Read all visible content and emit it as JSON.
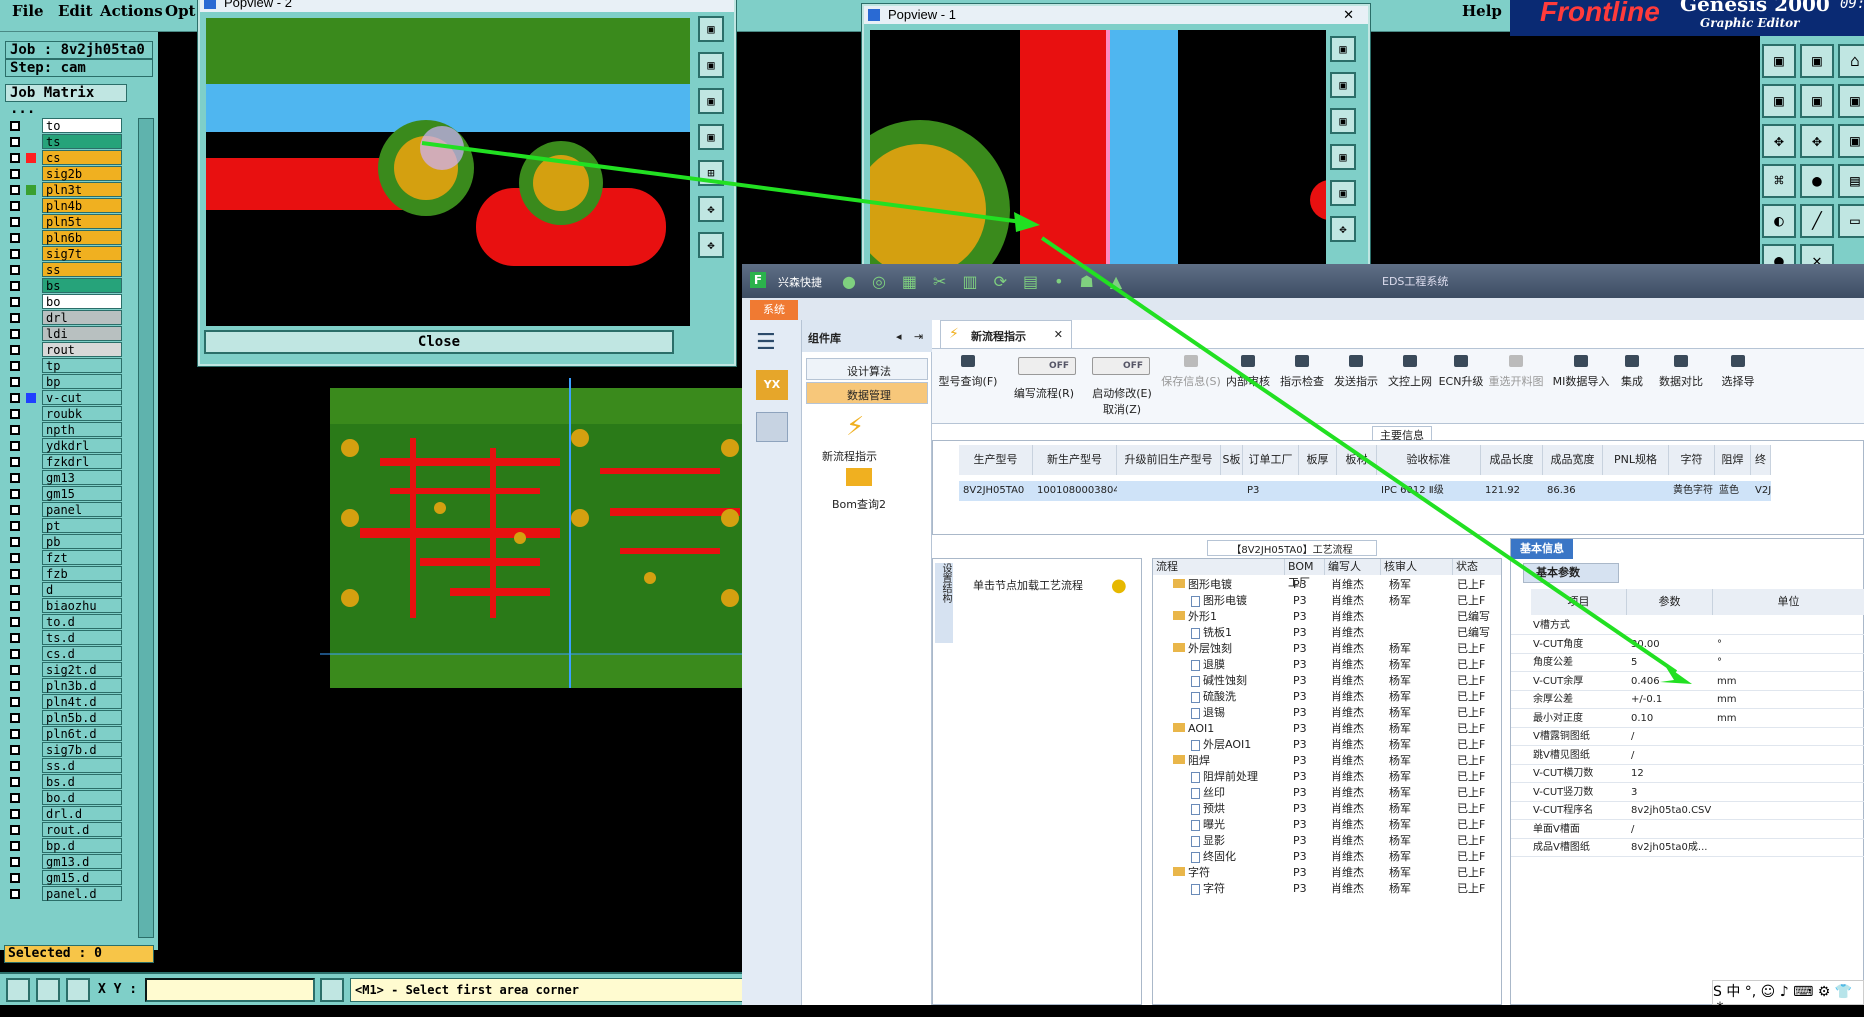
{
  "menubar": {
    "file": "File",
    "edit": "Edit",
    "actions": "Actions",
    "opt": "Opt",
    "help": "Help"
  },
  "branding": {
    "logo": "Frontline",
    "genesis": "Genesis 2000",
    "graphic_editor": "Graphic Editor",
    "clock": "09:3"
  },
  "job": {
    "job_label": "Job : 8v2jh05ta0",
    "step_label": "Step: cam",
    "matrix_button": "Job Matrix ..."
  },
  "layers": [
    {
      "name": "to",
      "color": "#ffffff",
      "swatch": ""
    },
    {
      "name": "ts",
      "color": "#26a37a",
      "swatch": ""
    },
    {
      "name": "cs",
      "color": "#f0b020",
      "swatch": "#ff2020"
    },
    {
      "name": "sig2b",
      "color": "#f0b020",
      "swatch": ""
    },
    {
      "name": "pln3t",
      "color": "#f0b020",
      "swatch": "#3aa030"
    },
    {
      "name": "pln4b",
      "color": "#f0b020",
      "swatch": ""
    },
    {
      "name": "pln5t",
      "color": "#f0b020",
      "swatch": ""
    },
    {
      "name": "pln6b",
      "color": "#f0b020",
      "swatch": ""
    },
    {
      "name": "sig7t",
      "color": "#f0b020",
      "swatch": ""
    },
    {
      "name": "ss",
      "color": "#f0b020",
      "swatch": ""
    },
    {
      "name": "bs",
      "color": "#26a37a",
      "swatch": ""
    },
    {
      "name": "bo",
      "color": "#ffffff",
      "swatch": ""
    },
    {
      "name": "drl",
      "color": "#b8c0c0",
      "swatch": ""
    },
    {
      "name": "ldi",
      "color": "#b8c0c0",
      "swatch": ""
    },
    {
      "name": "rout",
      "color": "#d8d8d8",
      "swatch": ""
    },
    {
      "name": "tp",
      "color": "#7fcfc8",
      "swatch": ""
    },
    {
      "name": "bp",
      "color": "#7fcfc8",
      "swatch": ""
    },
    {
      "name": "v-cut",
      "color": "#7fcfc8",
      "swatch": "#2040ff"
    },
    {
      "name": "roubk",
      "color": "#7fcfc8",
      "swatch": ""
    },
    {
      "name": "npth",
      "color": "#7fcfc8",
      "swatch": ""
    },
    {
      "name": "ydkdrl",
      "color": "#7fcfc8",
      "swatch": ""
    },
    {
      "name": "fzkdrl",
      "color": "#7fcfc8",
      "swatch": ""
    },
    {
      "name": "gm13",
      "color": "#7fcfc8",
      "swatch": ""
    },
    {
      "name": "gm15",
      "color": "#7fcfc8",
      "swatch": ""
    },
    {
      "name": "panel",
      "color": "#7fcfc8",
      "swatch": ""
    },
    {
      "name": "pt",
      "color": "#7fcfc8",
      "swatch": ""
    },
    {
      "name": "pb",
      "color": "#7fcfc8",
      "swatch": ""
    },
    {
      "name": "fzt",
      "color": "#7fcfc8",
      "swatch": ""
    },
    {
      "name": "fzb",
      "color": "#7fcfc8",
      "swatch": ""
    },
    {
      "name": "d",
      "color": "#7fcfc8",
      "swatch": ""
    },
    {
      "name": "biaozhu",
      "color": "#7fcfc8",
      "swatch": ""
    },
    {
      "name": "to.d",
      "color": "#7fcfc8",
      "swatch": ""
    },
    {
      "name": "ts.d",
      "color": "#7fcfc8",
      "swatch": ""
    },
    {
      "name": "cs.d",
      "color": "#7fcfc8",
      "swatch": ""
    },
    {
      "name": "sig2t.d",
      "color": "#7fcfc8",
      "swatch": ""
    },
    {
      "name": "pln3b.d",
      "color": "#7fcfc8",
      "swatch": ""
    },
    {
      "name": "pln4t.d",
      "color": "#7fcfc8",
      "swatch": ""
    },
    {
      "name": "pln5b.d",
      "color": "#7fcfc8",
      "swatch": ""
    },
    {
      "name": "pln6t.d",
      "color": "#7fcfc8",
      "swatch": ""
    },
    {
      "name": "sig7b.d",
      "color": "#7fcfc8",
      "swatch": ""
    },
    {
      "name": "ss.d",
      "color": "#7fcfc8",
      "swatch": ""
    },
    {
      "name": "bs.d",
      "color": "#7fcfc8",
      "swatch": ""
    },
    {
      "name": "bo.d",
      "color": "#7fcfc8",
      "swatch": ""
    },
    {
      "name": "drl.d",
      "color": "#7fcfc8",
      "swatch": ""
    },
    {
      "name": "rout.d",
      "color": "#7fcfc8",
      "swatch": ""
    },
    {
      "name": "bp.d",
      "color": "#7fcfc8",
      "swatch": ""
    },
    {
      "name": "gm13.d",
      "color": "#7fcfc8",
      "swatch": ""
    },
    {
      "name": "gm15.d",
      "color": "#7fcfc8",
      "swatch": ""
    },
    {
      "name": "panel.d",
      "color": "#7fcfc8",
      "swatch": ""
    }
  ],
  "selected_label": "Selected : 0",
  "status": {
    "xy_label": "X Y :",
    "xy_value": "",
    "prompt": "<M1> - Select first area corner"
  },
  "popview2": {
    "title": "Popview - 2",
    "close": "Close"
  },
  "popview1": {
    "title": "Popview - 1"
  },
  "eds": {
    "title": "EDS工程系统",
    "app_name": "兴森快捷",
    "sys_tab": "系统",
    "lib_title": "组件库",
    "lib_items": [
      "设计算法",
      "数据管理"
    ],
    "lib_links": [
      "新流程指示",
      "Bom查询2"
    ],
    "doc_tab": "新流程指示",
    "ribbon": [
      "型号查询(F)",
      "编写流程(R)",
      "启动修改(E)",
      "取消(Z)",
      "保存信息(S)",
      "内部审核",
      "指示检查",
      "发送指示",
      "文控上网",
      "ECN升级",
      "重选开料图",
      "MI数据导入",
      "集成",
      "数据对比",
      "选择导"
    ],
    "toggle": "OFF",
    "main_info": "主要信息",
    "grid_headers": [
      "生产型号",
      "新生产型号",
      "升级前旧生产型号",
      "S板",
      "订单工厂",
      "板厚",
      "板材",
      "验收标准",
      "成品长度",
      "成品宽度",
      "PNL规格",
      "字符",
      "阻焊",
      "终"
    ],
    "grid_row": [
      "8V2JH05TA0",
      "10010800038040",
      "",
      "",
      "P3",
      "",
      "",
      "IPC 6012 Ⅱ级",
      "121.92",
      "86.36",
      "",
      "黄色字符",
      "蓝色",
      "V2J"
    ],
    "flow_label": "【8V2JH05TA0】工艺流程",
    "left_vert": "设置结构",
    "add_flow": "单击节点加载工艺流程",
    "flow_headers": [
      "流程",
      "BOM工厂",
      "编写人",
      "核审人",
      "状态"
    ],
    "flow_rows": [
      {
        "lvl": 0,
        "t": "folder",
        "name": "图形电镀",
        "bom": "P3",
        "w": "肖维杰",
        "r": "杨军",
        "s": "已上F"
      },
      {
        "lvl": 1,
        "t": "doc",
        "name": "图形电镀",
        "bom": "P3",
        "w": "肖维杰",
        "r": "杨军",
        "s": "已上F"
      },
      {
        "lvl": 0,
        "t": "folder",
        "name": "外形1",
        "bom": "P3",
        "w": "肖维杰",
        "r": "",
        "s": "已编写"
      },
      {
        "lvl": 1,
        "t": "doc",
        "name": "铣板1",
        "bom": "P3",
        "w": "肖维杰",
        "r": "",
        "s": "已编写"
      },
      {
        "lvl": 0,
        "t": "folder",
        "name": "外层蚀刻",
        "bom": "P3",
        "w": "肖维杰",
        "r": "杨军",
        "s": "已上F"
      },
      {
        "lvl": 1,
        "t": "doc",
        "name": "退膜",
        "bom": "P3",
        "w": "肖维杰",
        "r": "杨军",
        "s": "已上F"
      },
      {
        "lvl": 1,
        "t": "doc",
        "name": "碱性蚀刻",
        "bom": "P3",
        "w": "肖维杰",
        "r": "杨军",
        "s": "已上F"
      },
      {
        "lvl": 1,
        "t": "doc",
        "name": "硫酸洗",
        "bom": "P3",
        "w": "肖维杰",
        "r": "杨军",
        "s": "已上F"
      },
      {
        "lvl": 1,
        "t": "doc",
        "name": "退锡",
        "bom": "P3",
        "w": "肖维杰",
        "r": "杨军",
        "s": "已上F"
      },
      {
        "lvl": 0,
        "t": "folder",
        "name": "AOI1",
        "bom": "P3",
        "w": "肖维杰",
        "r": "杨军",
        "s": "已上F"
      },
      {
        "lvl": 1,
        "t": "doc",
        "name": "外层AOI1",
        "bom": "P3",
        "w": "肖维杰",
        "r": "杨军",
        "s": "已上F"
      },
      {
        "lvl": 0,
        "t": "folder",
        "name": "阻焊",
        "bom": "P3",
        "w": "肖维杰",
        "r": "杨军",
        "s": "已上F"
      },
      {
        "lvl": 1,
        "t": "doc",
        "name": "阻焊前处理",
        "bom": "P3",
        "w": "肖维杰",
        "r": "杨军",
        "s": "已上F"
      },
      {
        "lvl": 1,
        "t": "doc",
        "name": "丝印",
        "bom": "P3",
        "w": "肖维杰",
        "r": "杨军",
        "s": "已上F"
      },
      {
        "lvl": 1,
        "t": "doc",
        "name": "预烘",
        "bom": "P3",
        "w": "肖维杰",
        "r": "杨军",
        "s": "已上F"
      },
      {
        "lvl": 1,
        "t": "doc",
        "name": "曝光",
        "bom": "P3",
        "w": "肖维杰",
        "r": "杨军",
        "s": "已上F"
      },
      {
        "lvl": 1,
        "t": "doc",
        "name": "显影",
        "bom": "P3",
        "w": "肖维杰",
        "r": "杨军",
        "s": "已上F"
      },
      {
        "lvl": 1,
        "t": "doc",
        "name": "终固化",
        "bom": "P3",
        "w": "肖维杰",
        "r": "杨军",
        "s": "已上F"
      },
      {
        "lvl": 0,
        "t": "folder",
        "name": "字符",
        "bom": "P3",
        "w": "肖维杰",
        "r": "杨军",
        "s": "已上F"
      },
      {
        "lvl": 1,
        "t": "doc",
        "name": "字符",
        "bom": "P3",
        "w": "肖维杰",
        "r": "杨军",
        "s": "已上F"
      }
    ],
    "basic_tab": "基本信息",
    "basic_params_tab": "基本参数",
    "basic_headers": [
      "项目",
      "参数",
      "单位"
    ],
    "basic_rows": [
      {
        "k": "V槽方式",
        "v": "",
        "u": ""
      },
      {
        "k": "V-CUT角度",
        "v": "30.00",
        "u": "°"
      },
      {
        "k": "角度公差",
        "v": "5",
        "u": "°"
      },
      {
        "k": "V-CUT余厚",
        "v": "0.406",
        "u": "mm"
      },
      {
        "k": "余厚公差",
        "v": "+/-0.1",
        "u": "mm"
      },
      {
        "k": "最小对正度",
        "v": "0.10",
        "u": "mm"
      },
      {
        "k": "V槽露铜图纸",
        "v": "/",
        "u": ""
      },
      {
        "k": "跳V槽见图纸",
        "v": "/",
        "u": ""
      },
      {
        "k": "V-CUT横刀数",
        "v": "12",
        "u": ""
      },
      {
        "k": "V-CUT竖刀数",
        "v": "3",
        "u": ""
      },
      {
        "k": "V-CUT程序名",
        "v": "8v2jh05ta0.CSV",
        "u": ""
      },
      {
        "k": "单面V槽面",
        "v": "/",
        "u": ""
      },
      {
        "k": "成品V槽图纸",
        "v": "8v2jh05ta0成...",
        "u": ""
      }
    ]
  },
  "ime": {
    "text": "S 中 °, ☺ ♪ ⌨ ⚙ 👕 ⁂"
  }
}
